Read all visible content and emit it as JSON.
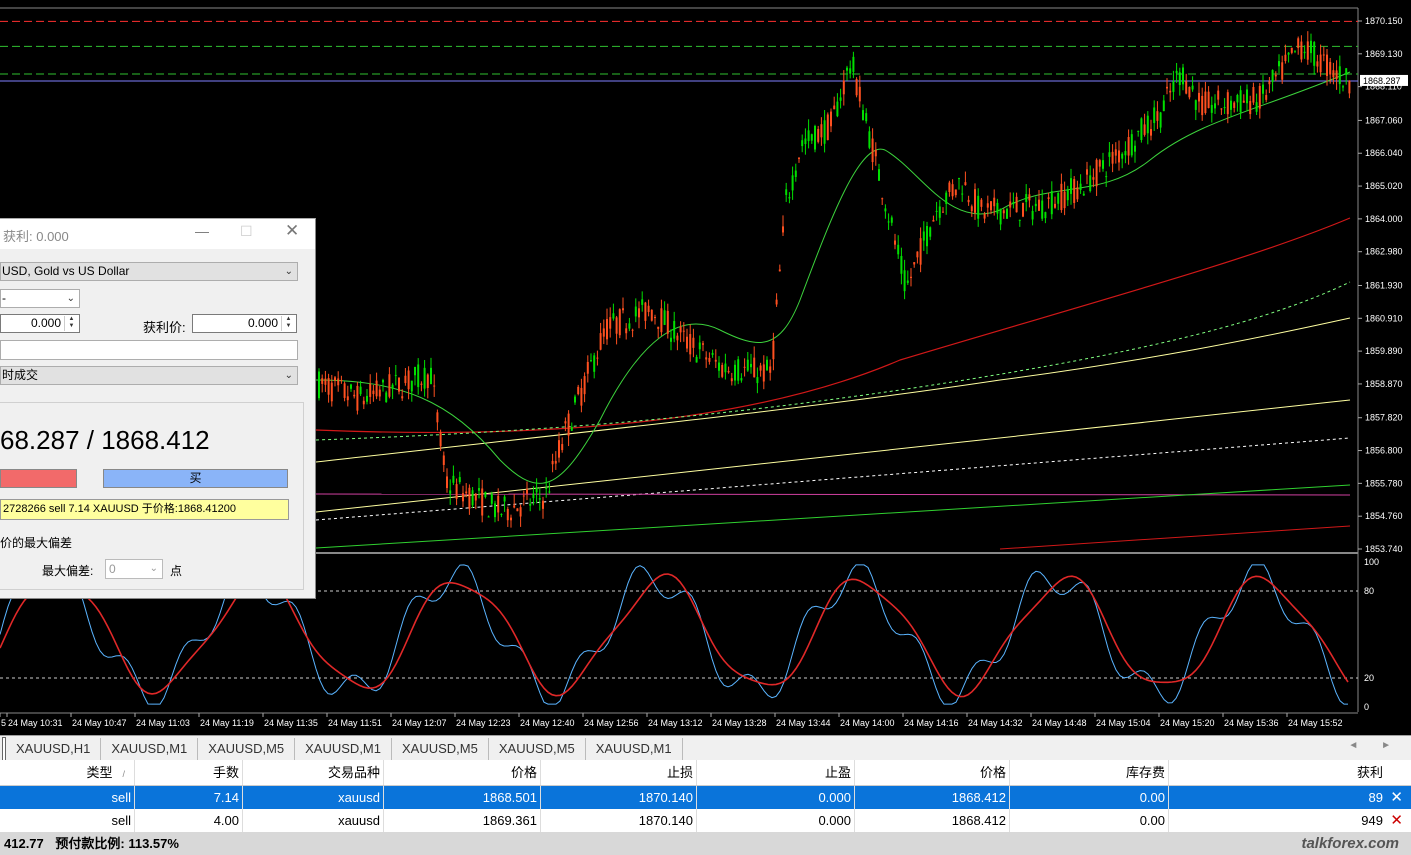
{
  "chart": {
    "price_axis": [
      "1870.150",
      "1869.130",
      "1868.110",
      "1867.060",
      "1866.040",
      "1865.020",
      "1864.000",
      "1862.980",
      "1861.930",
      "1860.910",
      "1859.890",
      "1858.870",
      "1857.820",
      "1856.800",
      "1855.780",
      "1854.760",
      "1853.740"
    ],
    "current_price_label": "1868.287",
    "osc_axis": [
      "100",
      "80",
      "20",
      "0"
    ],
    "time_axis": [
      "5",
      "24 May 10:31",
      "24 May 10:47",
      "24 May 11:03",
      "24 May 11:19",
      "24 May 11:35",
      "24 May 11:51",
      "24 May 12:07",
      "24 May 12:23",
      "24 May 12:40",
      "24 May 12:56",
      "24 May 13:12",
      "24 May 13:28",
      "24 May 13:44",
      "24 May 14:00",
      "24 May 14:16",
      "24 May 14:32",
      "24 May 14:48",
      "24 May 15:04",
      "24 May 15:20",
      "24 May 15:36",
      "24 May 15:52"
    ],
    "colors": {
      "bull": "#00e000",
      "bear": "#ff5020",
      "ma_fast": "#3cd23c",
      "ma_red": "#d01818",
      "ma_yellow": "#ffffa0",
      "stoch_main": "#e02828",
      "stoch_signal": "#5ab4ff"
    }
  },
  "tabs": [
    "XAUUSD,H1",
    "XAUUSD,M1",
    "XAUUSD,M5",
    "XAUUSD,M1",
    "XAUUSD,M5",
    "XAUUSD,M5",
    "XAUUSD,M1"
  ],
  "tab_nav": "◄ ►",
  "positions": {
    "headers": {
      "type": "类型",
      "lots": "手数",
      "symbol": "交易品种",
      "price": "价格",
      "sl": "止损",
      "tp": "止盈",
      "current": "价格",
      "swap": "库存费",
      "profit": "获利"
    },
    "sort_mark": "/",
    "rows": [
      {
        "type": "sell",
        "lots": "7.14",
        "symbol": "xauusd",
        "price": "1868.501",
        "sl": "1870.140",
        "tp": "0.000",
        "current": "1868.412",
        "swap": "0.00",
        "profit": "89"
      },
      {
        "type": "sell",
        "lots": "4.00",
        "symbol": "xauusd",
        "price": "1869.361",
        "sl": "1870.140",
        "tp": "0.000",
        "current": "1868.412",
        "swap": "0.00",
        "profit": "949"
      }
    ]
  },
  "status": {
    "balance": "412.77",
    "margin_level": "预付款比例: 113.57%",
    "brand": "talkforex.com"
  },
  "dialog": {
    "title": "获利: 0.000",
    "symbol": "USD, Gold vs US Dollar",
    "type": "-",
    "sl_value": "0.000",
    "tp_label": "获利价:",
    "tp_value": "0.000",
    "comment": "",
    "execution": "时成交",
    "quote": "68.287 / 1868.412",
    "buy_label": "买",
    "message": "2728266 sell 7.14 XAUUSD 于价格:1868.41200",
    "deviation_label": "价的最大偏差",
    "max_dev_label": "最大偏差:",
    "max_dev_value": "0",
    "points_label": "点"
  }
}
